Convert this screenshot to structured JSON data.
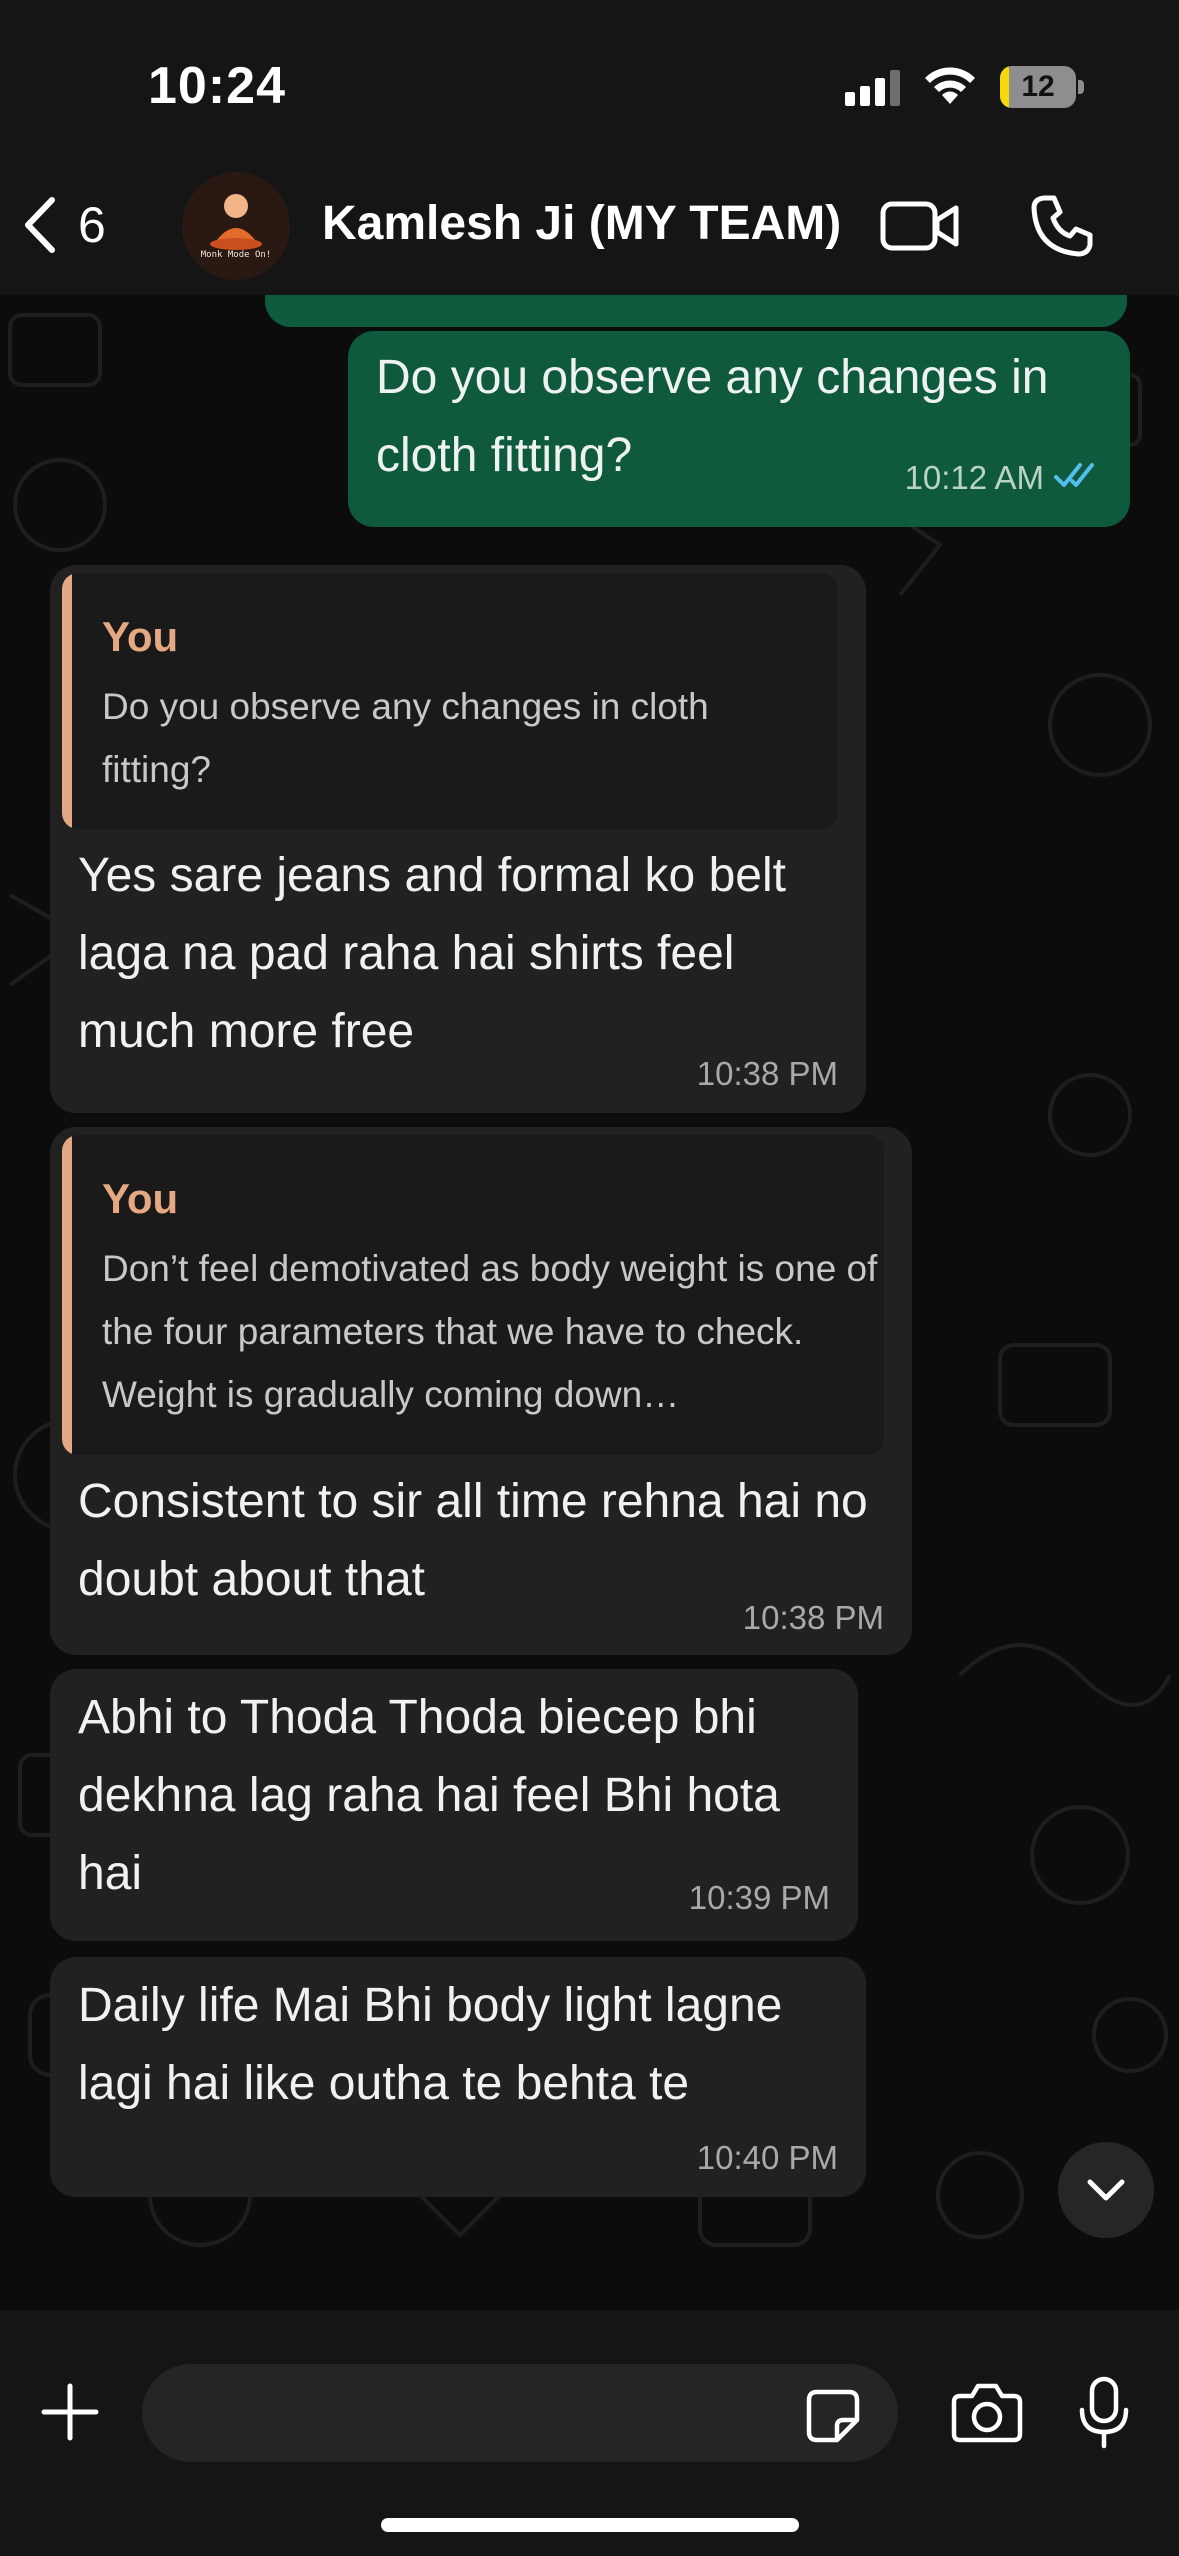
{
  "status_bar": {
    "time": "10:24",
    "battery_level": "12",
    "battery_fraction": 0.12,
    "signal_icon": "cellular-signal-icon",
    "wifi_icon": "wifi-icon"
  },
  "header": {
    "back_icon": "chevron-left-icon",
    "back_count": "6",
    "avatar_caption": "Monk Mode On!",
    "contact_name": "Kamlesh Ji (MY TEAM)",
    "video_icon": "video-camera-icon",
    "call_icon": "phone-icon"
  },
  "messages": [
    {
      "direction": "outgoing",
      "text": "Do you observe any changes in cloth fitting?",
      "time": "10:12 AM",
      "status": "read",
      "status_icon": "double-check-icon"
    },
    {
      "direction": "incoming",
      "reply_to": {
        "author": "You",
        "text": "Do you observe any changes in cloth fitting?"
      },
      "text": "Yes sare jeans and formal ko belt laga na pad raha hai shirts feel much more free",
      "time": "10:38 PM"
    },
    {
      "direction": "incoming",
      "reply_to": {
        "author": "You",
        "text": "Don’t feel demotivated as body weight is one of the four parameters that we have to check. Weight is gradually coming down…"
      },
      "text": "Consistent to sir all time rehna hai no doubt about that",
      "time": "10:38 PM"
    },
    {
      "direction": "incoming",
      "text": "Abhi to Thoda Thoda biecep bhi dekhna lag raha hai feel Bhi hota hai",
      "time": "10:39 PM"
    },
    {
      "direction": "incoming",
      "text": "Daily life Mai Bhi body light lagne lagi hai like outha te behta te",
      "time": "10:40 PM"
    }
  ],
  "scroll_down_icon": "chevron-down-icon",
  "composer": {
    "plus_icon": "plus-icon",
    "input_value": "",
    "input_placeholder": "",
    "sticker_icon": "sticker-icon",
    "camera_icon": "camera-icon",
    "mic_icon": "microphone-icon"
  },
  "colors": {
    "outgoing_bubble": "#0f5a3d",
    "incoming_bubble": "#212121",
    "quote_accent": "#e4a883",
    "read_ticks": "#53bdeb",
    "battery_fill": "#f5d90a"
  }
}
